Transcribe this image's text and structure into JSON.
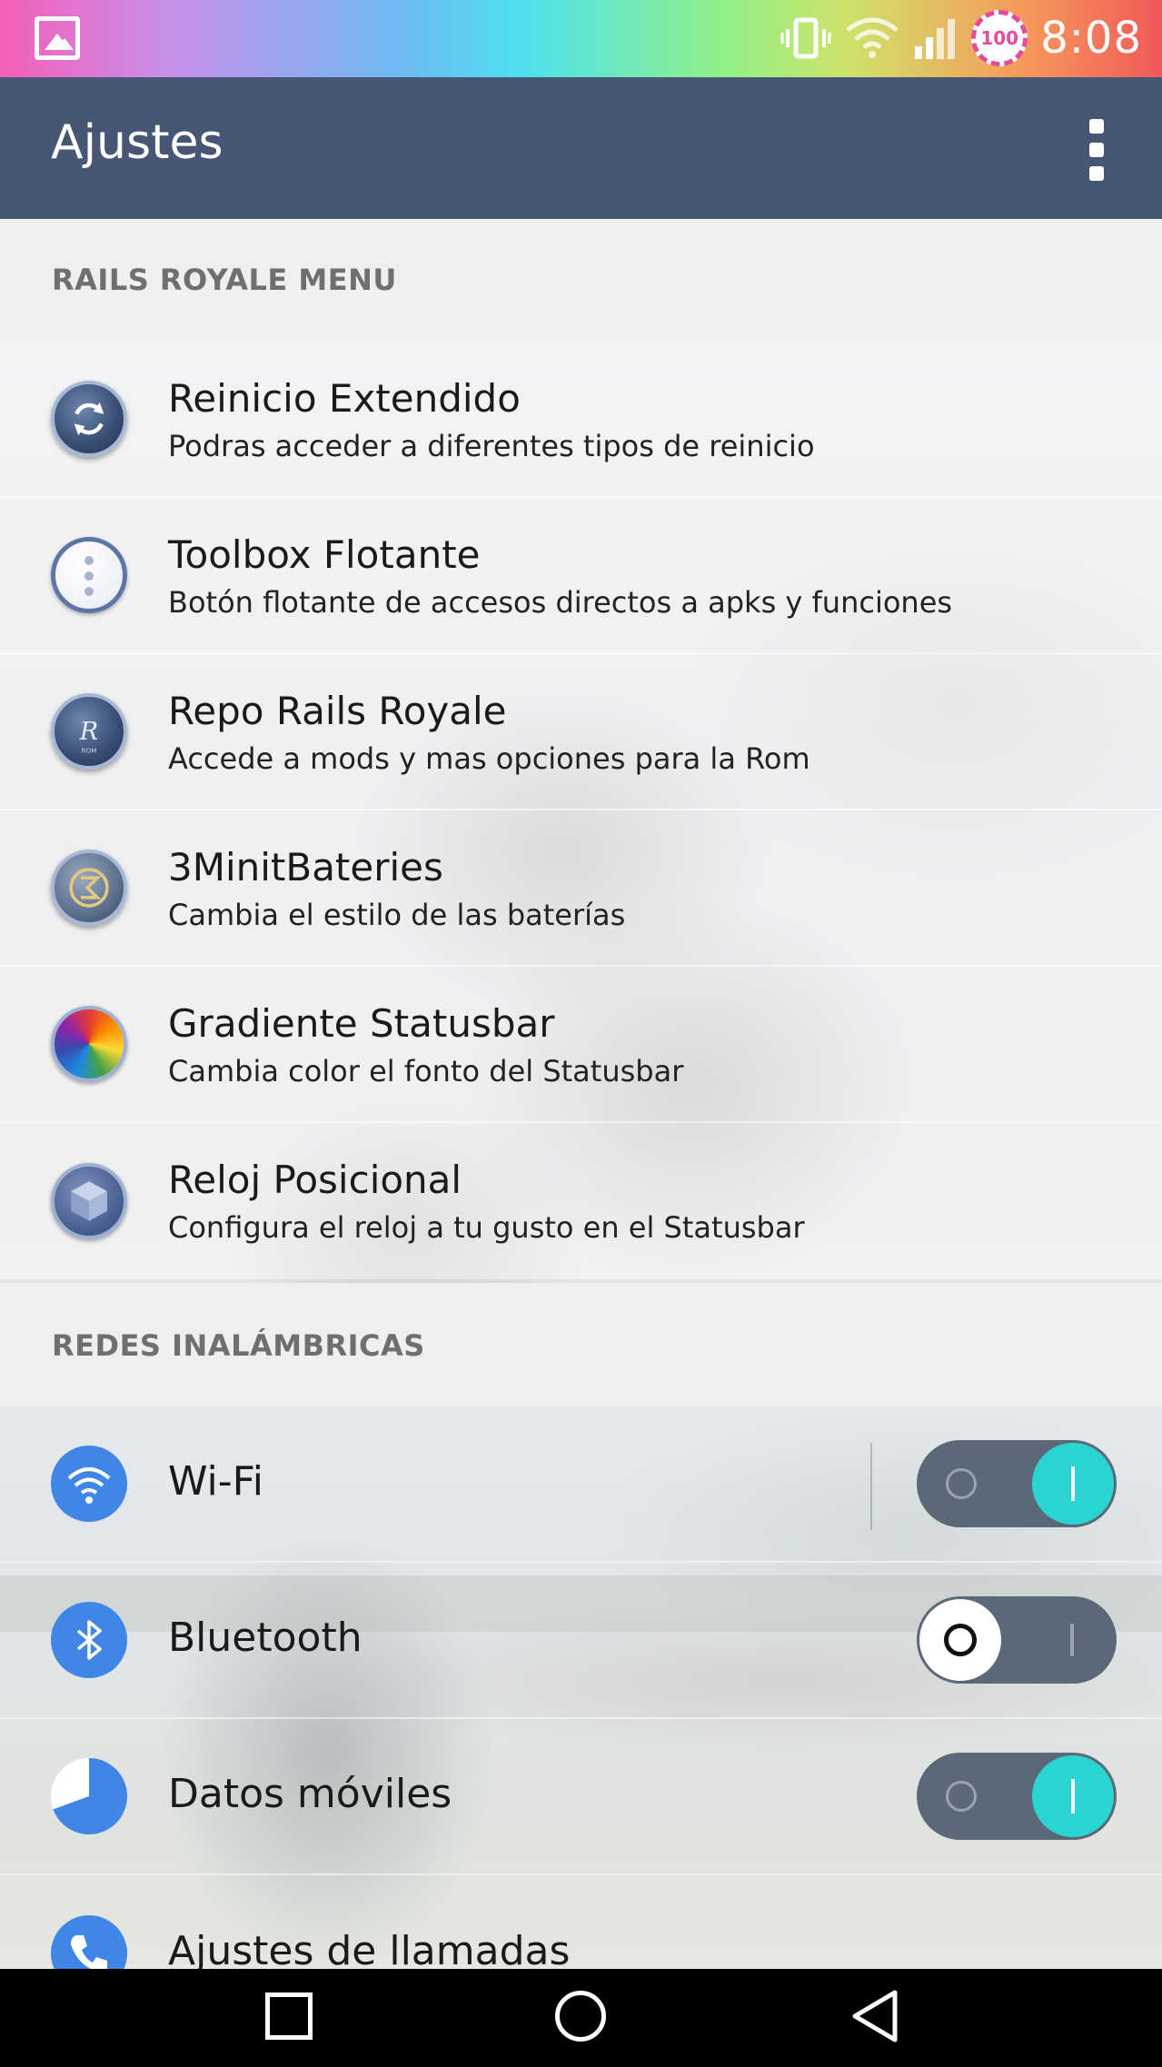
{
  "status_bar": {
    "battery_level": "100",
    "time": "8:08",
    "icons": [
      "image-icon",
      "vibrate-icon",
      "wifi-icon",
      "signal-icon",
      "battery-icon"
    ]
  },
  "app_bar": {
    "title": "Ajustes",
    "menu_icon": "more-vert-icon"
  },
  "sections": [
    {
      "header": "RAILS ROYALE MENU",
      "items": [
        {
          "title": "Reinicio Extendido",
          "subtitle": "Podras acceder a diferentes tipos de reinicio",
          "icon": "reboot-icon"
        },
        {
          "title": "Toolbox Flotante",
          "subtitle": "Botón flotante de accesos directos a apks y funciones",
          "icon": "toolbox-icon"
        },
        {
          "title": "Repo Rails Royale",
          "subtitle": "Accede a mods y mas opciones para la Rom",
          "icon": "rails-royale-logo-icon"
        },
        {
          "title": "3MinitBateries",
          "subtitle": "Cambia el estilo de las baterías",
          "icon": "battery-style-icon"
        },
        {
          "title": "Gradiente Statusbar",
          "subtitle": "Cambia color el fonto del Statusbar",
          "icon": "color-wheel-icon"
        },
        {
          "title": "Reloj Posicional",
          "subtitle": "Configura el reloj a tu gusto en el Statusbar",
          "icon": "clock-cube-icon"
        }
      ]
    },
    {
      "header": "REDES INALÁMBRICAS",
      "items": [
        {
          "title": "Wi-Fi",
          "icon": "wifi-icon",
          "toggle": "on"
        },
        {
          "title": "Bluetooth",
          "icon": "bluetooth-icon",
          "toggle": "off"
        },
        {
          "title": "Datos móviles",
          "icon": "mobile-data-icon",
          "toggle": "on"
        },
        {
          "title": "Ajustes de llamadas",
          "icon": "phone-icon"
        }
      ]
    }
  ],
  "nav_bar": {
    "buttons": [
      "recent-apps-icon",
      "home-icon",
      "back-icon"
    ]
  },
  "colors": {
    "app_bar": "#465674",
    "toggle_on": "#28d5d1",
    "toggle_track": "#5b6877",
    "section_header_text": "#6f6f6f"
  }
}
